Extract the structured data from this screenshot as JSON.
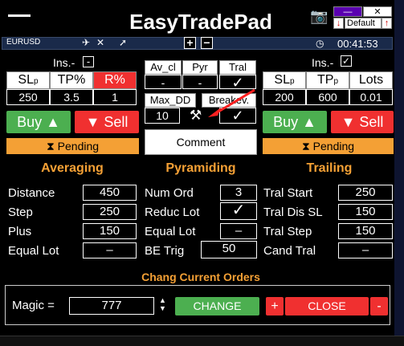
{
  "header": {
    "title": "EasyTradePad",
    "default_label": "Default",
    "minimize": "—",
    "close": "✕",
    "symbol": "EURUSD",
    "time": "00:41:53"
  },
  "left": {
    "ins_label": "Ins.-",
    "ins_value": "-",
    "headers": [
      "SL",
      "TP%",
      "R%"
    ],
    "sl_sub": "p",
    "values": [
      "250",
      "3.5",
      "1"
    ],
    "buy": "Buy",
    "sell": "Sell",
    "pending": "Pending"
  },
  "center": {
    "headers": [
      "Av_cl",
      "Pyr",
      "Tral"
    ],
    "values": [
      "-",
      "-",
      "✓"
    ],
    "maxdd_label": "Max_DD",
    "maxdd_value": "10",
    "breakev_label": "Breakev.",
    "breakev_value": "✓",
    "comment": "Comment"
  },
  "right": {
    "ins_label": "Ins.-",
    "ins_value": "✓",
    "headers": [
      "SL",
      "TP",
      "Lots"
    ],
    "sl_sub": "p",
    "tp_sub": "p",
    "values": [
      "200",
      "600",
      "0.01"
    ],
    "buy": "Buy",
    "sell": "Sell",
    "pending": "Pending"
  },
  "averaging": {
    "title": "Averaging",
    "rows": [
      {
        "label": "Distance",
        "value": "450"
      },
      {
        "label": "Step",
        "value": "250"
      },
      {
        "label": "Plus",
        "value": "150"
      },
      {
        "label": "Equal Lot",
        "value": "–"
      }
    ]
  },
  "pyramiding": {
    "title": "Pyramiding",
    "rows": [
      {
        "label": "Num Ord",
        "value": "3"
      },
      {
        "label": "Reduc Lot",
        "value": "✓"
      },
      {
        "label": "Equal Lot",
        "value": "–"
      },
      {
        "label": "BE Trig",
        "value": "50"
      }
    ]
  },
  "trailing": {
    "title": "Trailing",
    "rows": [
      {
        "label": "Tral Start",
        "value": "250"
      },
      {
        "label": "Tral Dis SL",
        "value": "150"
      },
      {
        "label": "Tral Step",
        "value": "150"
      },
      {
        "label": "Cand Tral",
        "value": "–"
      }
    ]
  },
  "orders": {
    "title": "Chang Current Orders",
    "magic_label": "Magic =",
    "magic_value": "777",
    "change": "CHANGE",
    "plus": "+",
    "close": "CLOSE",
    "minus": "-"
  },
  "icons": {
    "camera": "camera-icon",
    "settings": "tools-icon",
    "arrow": "red-arrow-annotation"
  },
  "colors": {
    "accent": "#f4a035",
    "buy": "#4caf50",
    "sell": "#f03030",
    "purple": "#5a00b0"
  }
}
